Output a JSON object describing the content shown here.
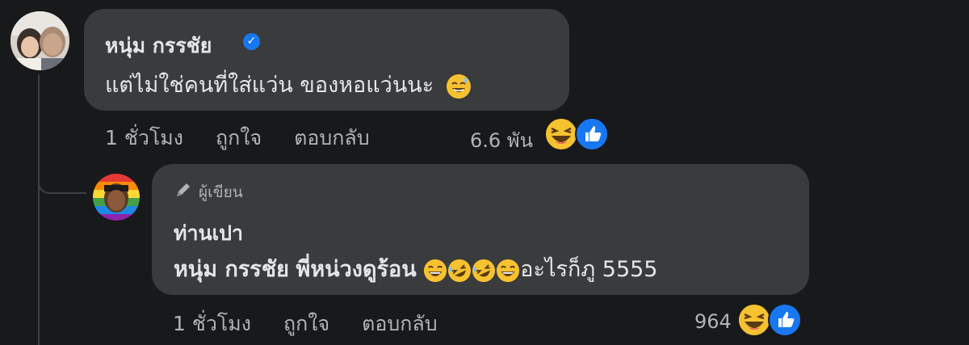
{
  "comment": {
    "author": "หนุ่ม กรรชัย",
    "text": "แต่ไม่ใช่คนที่ใส่แว่น ของหอแว่นนะ",
    "text_emoji": "sweat-smile-emoji",
    "time": "1 ชั่วโมง",
    "like_label": "ถูกใจ",
    "reply_label": "ตอบกลับ",
    "reaction_count": "6.6 พัน",
    "reaction_icons": [
      "haha-icon",
      "like-icon"
    ],
    "verified_icon": "verified-badge-icon",
    "accent_color": "#1877f2"
  },
  "reply": {
    "badge_label": "ผู้เขียน",
    "badge_icon": "pen-icon",
    "author": "ท่านเปา",
    "mention": "หนุ่ม กรรชัย",
    "text": "พี่หน่วงดูร้อน",
    "emojis": [
      "laughing-emoji",
      "rofl-emoji",
      "rofl-emoji",
      "laughing-emoji"
    ],
    "text_suffix": "อะไรก็ภู 5555",
    "time": "1 ชั่วโมง",
    "like_label": "ถูกใจ",
    "reply_label": "ตอบกลับ",
    "reaction_count": "964",
    "reaction_icons": [
      "haha-icon",
      "like-icon"
    ]
  },
  "colors": {
    "background": "#18191a",
    "bubble": "#3a3b3c",
    "primary_text": "#e4e6eb",
    "secondary_text": "#b0b3b8",
    "like_blue": "#1877f2",
    "emoji_yellow": "#f7c22f"
  }
}
